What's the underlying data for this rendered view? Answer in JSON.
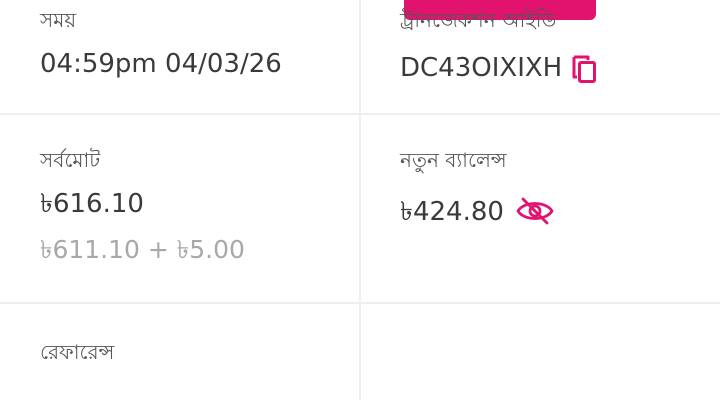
{
  "time": {
    "label": "সময়",
    "value": "04:59pm 04/03/26"
  },
  "transaction": {
    "label": "ট্রানজেকশন আইডি",
    "value": "DC43OIXIXH",
    "copy_icon": "copy-icon"
  },
  "total": {
    "label": "সর্বমোট",
    "value": "৳616.10",
    "breakdown": "৳611.10 + ৳5.00"
  },
  "new_balance": {
    "label": "নতুন ব্যালেন্স",
    "value": "৳424.80",
    "toggle_icon": "eye-off-icon"
  },
  "reference": {
    "label": "রেফারেন্স"
  },
  "colors": {
    "accent": "#e2136e",
    "divider": "#efefef",
    "label": "#555555",
    "value": "#3a3a3a",
    "muted": "#a8a8a8"
  }
}
